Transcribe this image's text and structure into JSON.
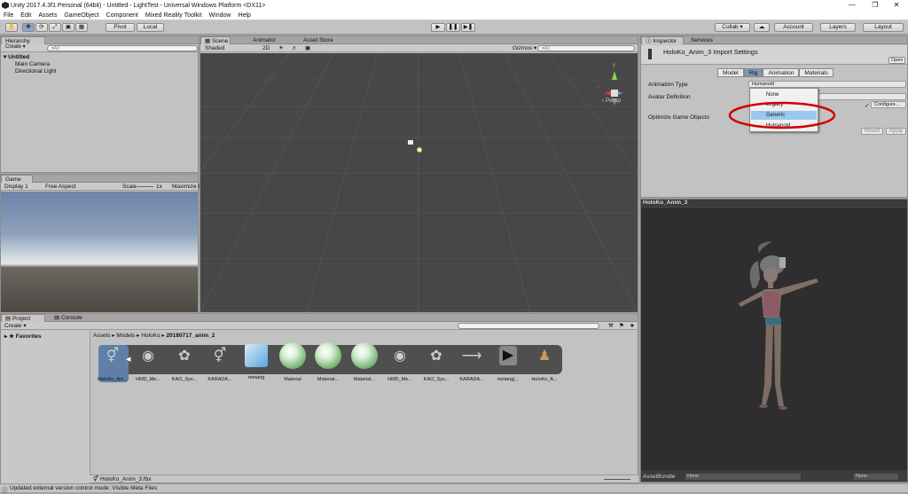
{
  "window": {
    "title": "Unity 2017.4.3f1 Personal (64bit) - Untitled - LightTest - Universal Windows Platform <DX11>"
  },
  "menu": [
    "File",
    "Edit",
    "Assets",
    "GameObject",
    "Component",
    "Mixed Reality Toolkit",
    "Window",
    "Help"
  ],
  "toolbar": {
    "pivot": "Pivot",
    "local": "Local",
    "collab": "Collab ▾",
    "account": "Account",
    "layers": "Layers",
    "layout": "Layout"
  },
  "hierarchy": {
    "tab": "Hierarchy",
    "create": "Create ▾",
    "search_placeholder": "▾All",
    "scene": "Untitled",
    "items": [
      "Main Camera",
      "Directional Light"
    ]
  },
  "scene": {
    "tabs": [
      "Scene",
      "Animator",
      "Asset Store"
    ],
    "shading": "Shaded",
    "mode2d": "2D",
    "gizmos": "Gizmos ▾",
    "search_placeholder": "▾All",
    "persp": "‹ Persp"
  },
  "game": {
    "tab": "Game",
    "display": "Display 1",
    "aspect": "Free Aspect",
    "scale_label": "Scale",
    "scale_value": "1x",
    "maximize": "Maximize O"
  },
  "inspector": {
    "tabs": [
      "Inspector",
      "Services"
    ],
    "title": "HoloKo_Anim_3 Import Settings",
    "open": "Open",
    "subtabs": [
      "Model",
      "Rig",
      "Animation",
      "Materials"
    ],
    "animation_type_label": "Animation Type",
    "animation_type_value": "Humanoid",
    "avatar_def_label": "Avatar Definition",
    "configure": "Configure...",
    "optimize_label": "Optimize Game Objects",
    "revert": "Revert",
    "apply": "Apply",
    "dropdown_options": [
      "None",
      "Legacy",
      "Generic",
      "Humanoid"
    ],
    "selected_option": "Generic",
    "check": "✓"
  },
  "preview": {
    "title": "HoloKo_Anim_3",
    "assetbundle_label": "AssetBundle",
    "bundle_value": "None",
    "variant_value": "None"
  },
  "project": {
    "tabs": [
      "Project",
      "Console"
    ],
    "create": "Create ▾",
    "favorites": "Favorites",
    "breadcrumb": [
      "Assets",
      "Models",
      "HoloKo",
      "20180717_anim_2"
    ],
    "assets": [
      "HoloKo_Ani...",
      "HMD_Me...",
      "KAO_Sys...",
      "KARADA...",
      "metarig",
      "Material",
      "Material...",
      "Material...",
      "HMD_Me...",
      "KAO_Sys...",
      "KARADA...",
      "metarig|...",
      "HoloKo_A..."
    ],
    "selected_file": "HoloKo_Anim_3.fbx"
  },
  "status": {
    "text": "Updated external version control mode: Visible Meta Files"
  }
}
